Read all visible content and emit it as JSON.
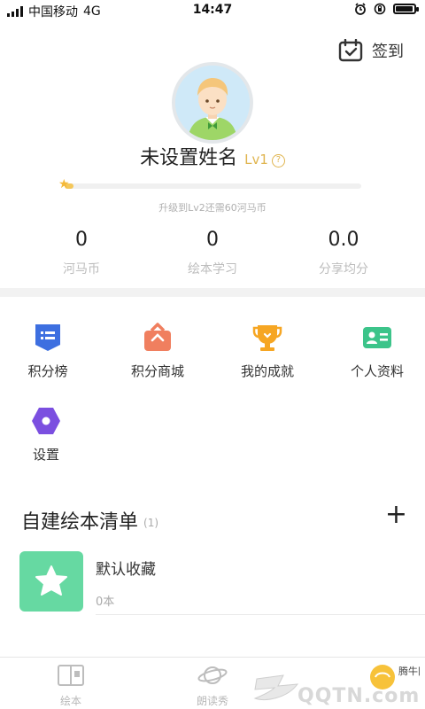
{
  "status_bar": {
    "carrier": "中国移动",
    "network": "4G",
    "time": "14:47",
    "battery_level": 0.85
  },
  "header": {
    "checkin_label": "签到",
    "checkin_icon": "calendar-check-icon"
  },
  "profile": {
    "name": "未设置姓名",
    "level": "Lv1",
    "level_progress": 0.03,
    "upgrade_hint": "升级到Lv2还需60河马币",
    "stats": [
      {
        "value": "0",
        "label": "河马币"
      },
      {
        "value": "0",
        "label": "绘本学习"
      },
      {
        "value": "0.0",
        "label": "分享均分"
      }
    ]
  },
  "menu": {
    "items": [
      {
        "label": "积分榜",
        "icon": "leaderboard-icon",
        "color": "#3d6fe0"
      },
      {
        "label": "积分商城",
        "icon": "gift-icon",
        "color": "#f07f5f"
      },
      {
        "label": "我的成就",
        "icon": "trophy-icon",
        "color": "#f6a623"
      },
      {
        "label": "个人资料",
        "icon": "id-card-icon",
        "color": "#3cc48a"
      },
      {
        "label": "设置",
        "icon": "settings-hexagon-icon",
        "color": "#7b4fe0"
      }
    ]
  },
  "booklists": {
    "title": "自建绘本清单",
    "count": "(1)",
    "items": [
      {
        "title": "默认收藏",
        "count": "0本",
        "icon": "star-icon",
        "color": "#66d9a2"
      }
    ]
  },
  "tabbar": {
    "tabs": [
      {
        "label": "绘本",
        "icon": "book-icon"
      },
      {
        "label": "朗读秀",
        "icon": "planet-icon"
      }
    ]
  },
  "watermark": {
    "text": "QQTN.com",
    "brand": "腾牛网"
  }
}
